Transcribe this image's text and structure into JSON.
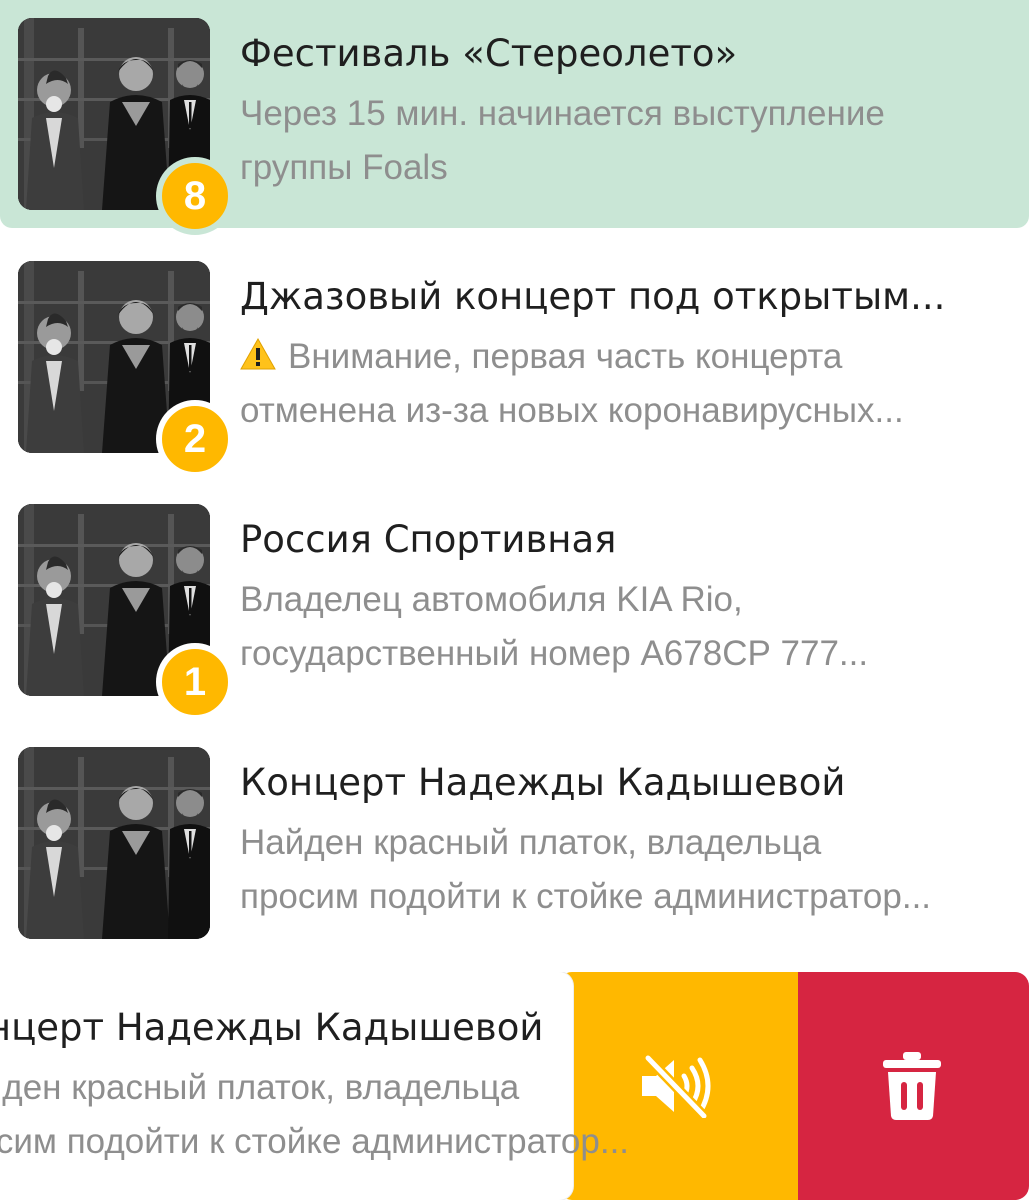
{
  "colors": {
    "highlight_bg": "#c9e6d6",
    "badge": "#ffb800",
    "mute_action": "#ffb800",
    "delete_action": "#d62541",
    "title_text": "#1f1f1f",
    "preview_text": "#8e8e8e"
  },
  "chats": [
    {
      "title": "Фестиваль «Стереолето»",
      "preview_line1": "Через 15 мин. начинается выступление",
      "preview_line2": "группы Foals",
      "unread": "8",
      "highlighted": true
    },
    {
      "title": "Джазовый концерт под открытым...",
      "warning_icon": "warning-icon",
      "preview_line1": "Внимание, первая часть концерта",
      "preview_line2": "отменена из-за новых коронавирусных...",
      "unread": "2"
    },
    {
      "title": "Россия Спортивная",
      "preview_line1": "Владелец автомобиля  KIA Rio,",
      "preview_line2": "государственный номер А678СР 777...",
      "unread": "1"
    },
    {
      "title": "Концерт Надежды Кадышевой",
      "preview_line1": "Найден красный платок, владельца",
      "preview_line2": "просим подойти к стойке администратор..."
    }
  ],
  "swiped_row": {
    "title": "Концерт Надежды Кадышевой",
    "preview_line1": "Найден красный платок, владельца",
    "preview_line2": "просим подойти к стойке администратор...",
    "actions": [
      {
        "name": "mute",
        "icon": "mute-icon"
      },
      {
        "name": "delete",
        "icon": "trash-icon"
      }
    ]
  }
}
